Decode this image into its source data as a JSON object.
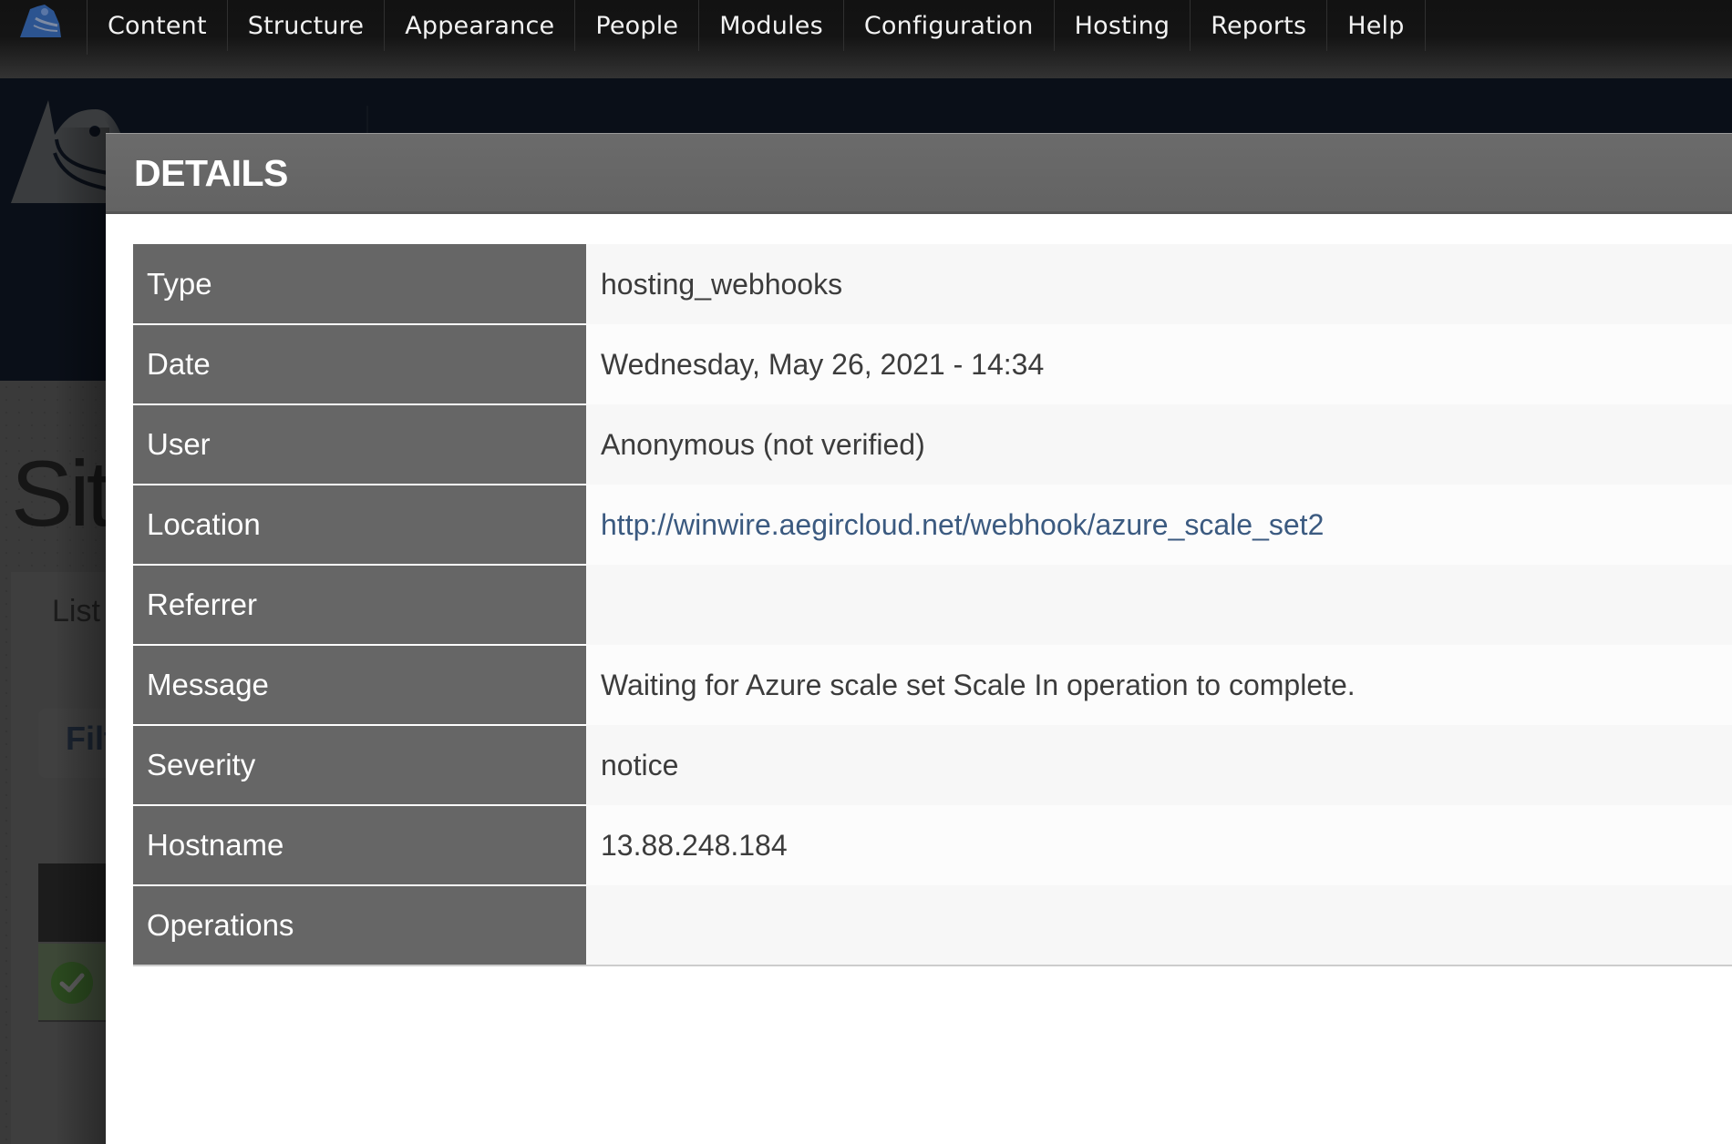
{
  "toolbar": {
    "logo_icon": "druplicon-icon",
    "items": [
      {
        "label": "Content"
      },
      {
        "label": "Structure"
      },
      {
        "label": "Appearance"
      },
      {
        "label": "People"
      },
      {
        "label": "Modules"
      },
      {
        "label": "Configuration"
      },
      {
        "label": "Hosting"
      },
      {
        "label": "Reports"
      },
      {
        "label": "Help"
      }
    ]
  },
  "background_page": {
    "title_partial": "Sit",
    "tab_partial": "List",
    "filter_partial": "Filt",
    "status_icon": "check-circle-icon"
  },
  "modal": {
    "title": "DETAILS",
    "rows": [
      {
        "label": "Type",
        "value": "hosting_webhooks"
      },
      {
        "label": "Date",
        "value": "Wednesday, May 26, 2021 - 14:34"
      },
      {
        "label": "User",
        "value": "Anonymous (not verified)"
      },
      {
        "label": "Location",
        "value": "http://winwire.aegircloud.net/webhook/azure_scale_set2",
        "is_link": true
      },
      {
        "label": "Referrer",
        "value": ""
      },
      {
        "label": "Message",
        "value": "Waiting for Azure scale set Scale In operation to complete."
      },
      {
        "label": "Severity",
        "value": "notice"
      },
      {
        "label": "Hostname",
        "value": "13.88.248.184"
      },
      {
        "label": "Operations",
        "value": ""
      }
    ]
  },
  "colors": {
    "toolbar_bg": "#121212",
    "header_navy": "#0a0f18",
    "modal_header": "#666666",
    "label_bg": "#666666",
    "link": "#3b5a80",
    "logo_blue": "#2c5490"
  }
}
